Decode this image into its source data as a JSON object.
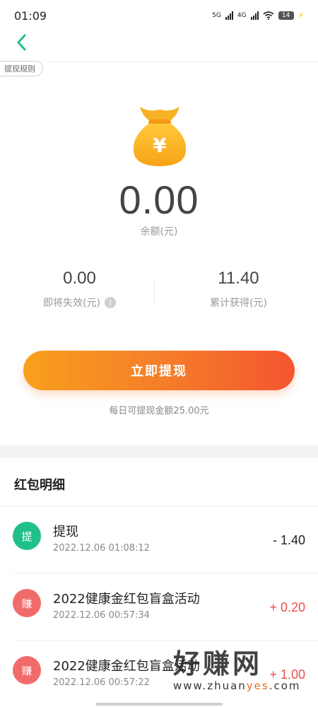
{
  "status_bar": {
    "time": "01:09",
    "network_1": "5G",
    "network_2": "4G",
    "battery": "14"
  },
  "header": {
    "rules_label": "提现规则"
  },
  "balance": {
    "amount": "0.00",
    "label": "余额(元)"
  },
  "stats": {
    "expiring_value": "0.00",
    "expiring_label": "即将失效(元)",
    "total_value": "11.40",
    "total_label": "累计获得(元)"
  },
  "withdraw": {
    "button_label": "立即提现",
    "daily_limit": "每日可提现金额25.00元"
  },
  "details": {
    "title": "红包明细",
    "records": [
      {
        "badge": "提",
        "title": "提现",
        "time": "2022.12.06 01:08:12",
        "amount": "- 1.40",
        "badge_color": "#21c08b",
        "amount_color": "#222222"
      },
      {
        "badge": "赚",
        "title": "2022健康金红包盲盒活动",
        "time": "2022.12.06 00:57:34",
        "amount": "+ 0.20",
        "badge_color": "#f26b6b",
        "amount_color": "#f04b4b"
      },
      {
        "badge": "赚",
        "title": "2022健康金红包盲盒活动",
        "time": "2022.12.06 00:57:22",
        "amount": "+ 1.00",
        "badge_color": "#f26b6b",
        "amount_color": "#f04b4b"
      }
    ]
  },
  "watermark": {
    "brand": "好赚网",
    "url_prefix": "www.zhuan",
    "url_accent": "yes",
    "url_suffix": ".com"
  },
  "colors": {
    "accent_green": "#21c08b",
    "button_start": "#f8a01c",
    "button_end": "#f4552f"
  },
  "icons": {
    "back": "chevron-left-icon",
    "bag": "money-bag-icon",
    "info": "info-icon"
  }
}
